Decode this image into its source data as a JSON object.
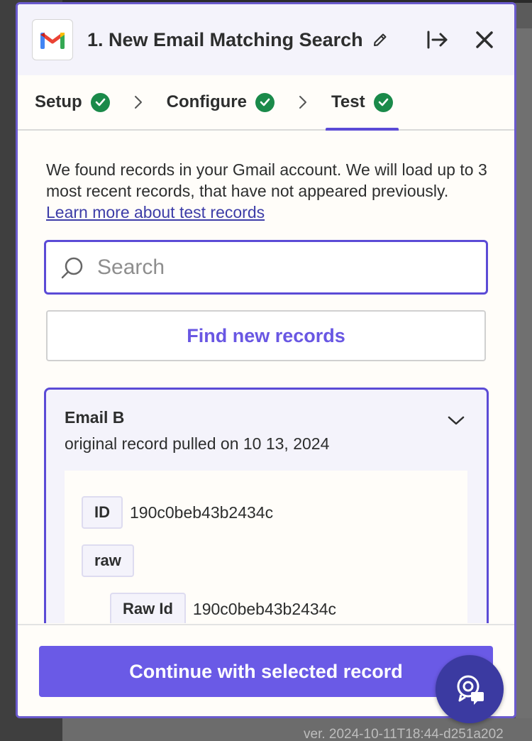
{
  "colors": {
    "accent": "#5b4bd6",
    "button": "#6a5ae6",
    "success": "#1a8a4a",
    "link": "#3d3da8",
    "fab": "#3b3aa1"
  },
  "background": {
    "version_text": "ver. 2024-10-11T18:44-d251a202"
  },
  "header": {
    "app_icon": "gmail-icon",
    "title": "1. New Email Matching Search",
    "edit_icon": "pencil-icon",
    "expand_icon": "arrow-right-to-line-icon",
    "close_icon": "close-icon"
  },
  "steps": [
    {
      "label": "Setup",
      "status": "complete"
    },
    {
      "label": "Configure",
      "status": "complete"
    },
    {
      "label": "Test",
      "status": "complete",
      "active": true
    }
  ],
  "content": {
    "intro": "We found records in your Gmail account. We will load up to 3 most recent records, that have not appeared previously.",
    "learn_link": "Learn more about test records",
    "search_placeholder": "Search",
    "find_button": "Find new records"
  },
  "record": {
    "title": "Email B",
    "subtitle": "original record pulled on 10 13, 2024",
    "fields": [
      {
        "key": "ID",
        "value": "190c0beb43b2434c"
      },
      {
        "key": "raw",
        "value": ""
      },
      {
        "key": "Raw Id",
        "value": "190c0beb43b2434c"
      }
    ]
  },
  "footer": {
    "continue_label": "Continue with selected record"
  },
  "help": {
    "icon": "support-chat-icon"
  }
}
